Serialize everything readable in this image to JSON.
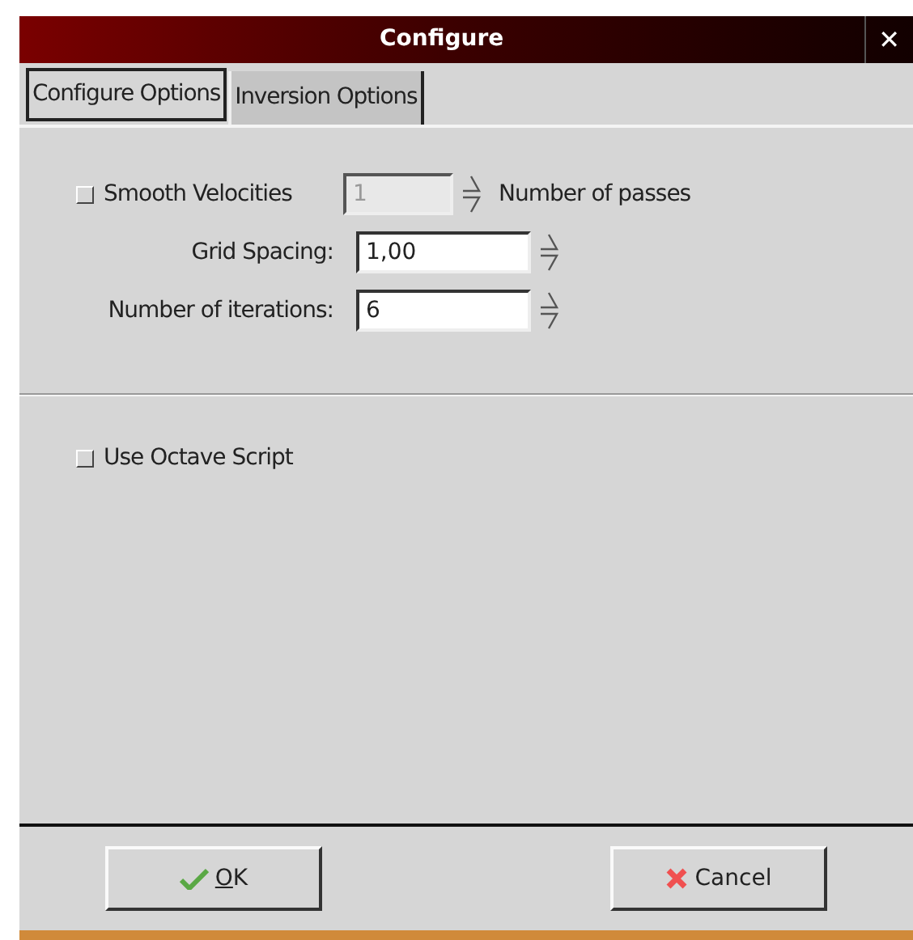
{
  "window": {
    "title": "Configure",
    "close": "✕"
  },
  "tabs": [
    {
      "label": "Configure Options",
      "selected": true
    },
    {
      "label": "Inversion Options",
      "selected": false
    }
  ],
  "smooth": {
    "label": "Smooth Velocities",
    "checked": false,
    "value": "1",
    "disabled": true,
    "suffix": "Number of passes"
  },
  "fields": [
    {
      "label": "Grid Spacing:",
      "value": "1,00"
    },
    {
      "label": "Number of iterations:",
      "value": "6"
    }
  ],
  "octave": {
    "label": "Use Octave Script",
    "checked": false
  },
  "buttons": [
    {
      "label": "OK",
      "kind": "ok",
      "mnemonic": true
    },
    {
      "label": "Cancel",
      "kind": "cancel",
      "mnemonic": false
    }
  ]
}
